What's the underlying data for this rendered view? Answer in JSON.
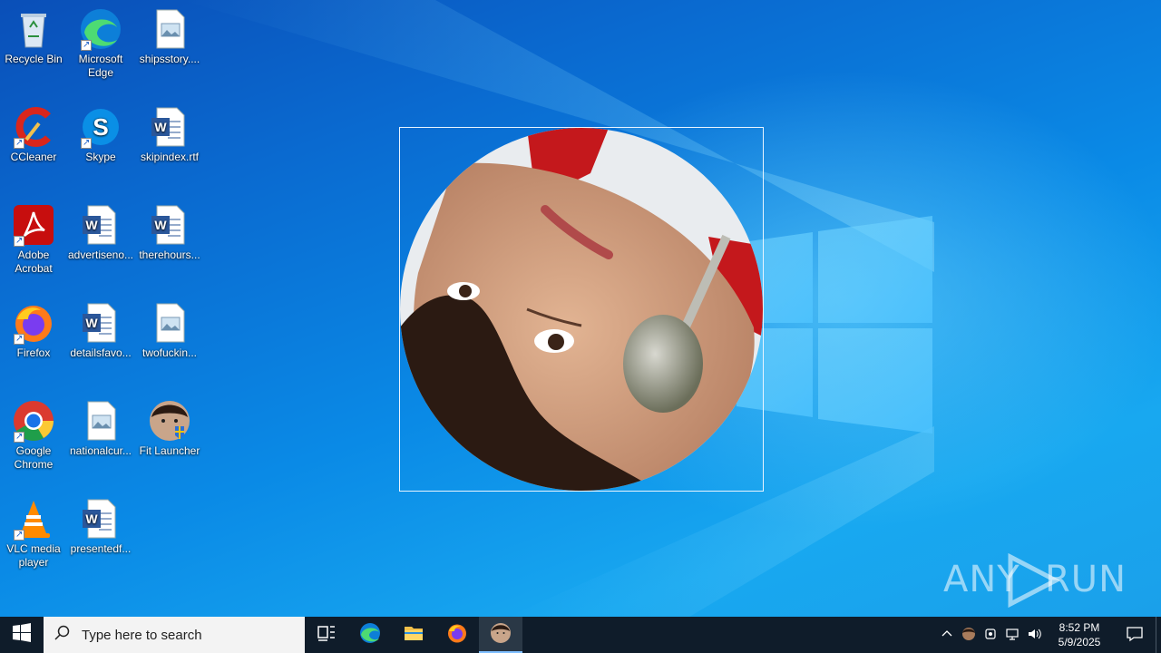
{
  "desktop": {
    "icons": [
      {
        "label": "Recycle Bin",
        "icon": "recycle-bin-icon"
      },
      {
        "label": "Microsoft Edge",
        "icon": "edge-icon"
      },
      {
        "label": "shipsstory....",
        "icon": "image-file-icon"
      },
      {
        "label": "CCleaner",
        "icon": "ccleaner-icon"
      },
      {
        "label": "Skype",
        "icon": "skype-icon"
      },
      {
        "label": "skipindex.rtf",
        "icon": "word-doc-icon"
      },
      {
        "label": "Adobe Acrobat",
        "icon": "acrobat-icon"
      },
      {
        "label": "advertiseno...",
        "icon": "word-doc-icon"
      },
      {
        "label": "therehours...",
        "icon": "word-doc-icon"
      },
      {
        "label": "Firefox",
        "icon": "firefox-icon"
      },
      {
        "label": "detailsfavo...",
        "icon": "word-doc-icon"
      },
      {
        "label": "twofuckin...",
        "icon": "image-file-icon"
      },
      {
        "label": "Google Chrome",
        "icon": "chrome-icon"
      },
      {
        "label": "nationalcur...",
        "icon": "image-file-icon"
      },
      {
        "label": "Fit Launcher",
        "icon": "fit-launcher-icon"
      },
      {
        "label": "VLC media player",
        "icon": "vlc-icon"
      },
      {
        "label": "presentedf...",
        "icon": "word-doc-icon"
      }
    ]
  },
  "watermark": {
    "left": "ANY",
    "right": "RUN"
  },
  "taskbar": {
    "search_placeholder": "Type here to search",
    "time": "8:52 PM",
    "date": "5/9/2025"
  },
  "colors": {
    "wallpaper": "#0a78d7",
    "taskbar": "#0f1c2a"
  }
}
